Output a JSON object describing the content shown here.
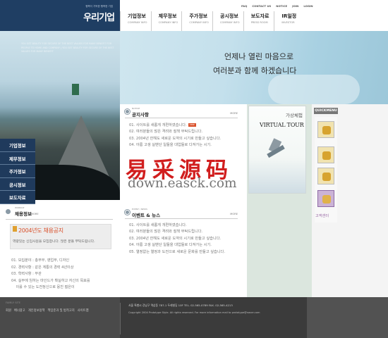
{
  "header": {
    "logo_sub": "행복이 가득한 행복한 기업",
    "logo": "우리기업",
    "util_links": [
      "FAQ",
      "CONTACT US",
      "NOTICE",
      "JOIN",
      "LOGIN"
    ],
    "nav": [
      {
        "ko": "기업정보",
        "en": "COMPANY INFO"
      },
      {
        "ko": "제무정보",
        "en": "COMPANY INFO"
      },
      {
        "ko": "주가정보",
        "en": "COMPANY INFO"
      },
      {
        "ko": "공시정보",
        "en": "COMPANY INFO"
      },
      {
        "ko": "보도자료",
        "en": "PRESS ROOM"
      },
      {
        "ko": "IR일정",
        "en": "INVESTOR"
      }
    ]
  },
  "photo": {
    "tagline": "YOU GET BEAUTY FOR SECURE OF THE BEST VALUES FOR MANY BENEFIT FOR PEOPLE TO HOME AND COMPANY | YOU GET BEAUTY FOR SECURE OF THE BEST VALUES FOR MANY BENEFIT"
  },
  "hero": {
    "line1": "언제나 열린 마음으로",
    "line2": "여러분과 함께 하겠습니다"
  },
  "submenu": [
    "기업정보",
    "제무정보",
    "주가정보",
    "공시정보",
    "보도자료"
  ],
  "notice": {
    "small": "NOTICE",
    "title": "공지사항",
    "more": "MORE",
    "new_badge": "new",
    "items": [
      "01. 사이트를 새롭게 개편하였습니다.",
      "02. 여러분들의 많은 격려와 질책 부탁드립니다.",
      "03. 2004년 한해도 새로운 도약의 시기로 만들고 싶습니다.",
      "04. 아름 고생 실밴단 일들을 대업들로 다져가는 시기."
    ]
  },
  "events": {
    "small": "EVENT / NEWS",
    "title": "이벤트 & 뉴스",
    "more": "MORE",
    "items": [
      "01. 사이트를 새롭게 개편하였습니다.",
      "02. 여러분들의 많은 격려와 질책 부탁드립니다.",
      "03. 2004년 한해도 새로운 도약의 시기로 만들고 싶습니다.",
      "04. 아름 고생 실밴단 일들을 대업들로 다져가는 시기.",
      "05. 열정없는 열정과 도전으로 새로운 문화를 만들고 싶습니다."
    ]
  },
  "tour": {
    "ko": "가상체험",
    "en": "VIRTUAL TOUR"
  },
  "watermark": {
    "cn": "易采源码",
    "url": "down.easck.com"
  },
  "quickmenu": {
    "title": "QUICKMENU",
    "label": "고객센터"
  },
  "recruit": {
    "small": "WORKUP",
    "title": "채용정보",
    "more": "MORE",
    "box_title": "2004년도 채용공지",
    "box_desc": "역량있는 신입사원을 모집합니다. 많은 분들 부탁드립니다.",
    "items": [
      "01. 모집분야 : 총무부, 영업부, 디자인",
      "02. 경력사항 : 같은 계통의 경력 4년이상",
      "03. 학력사항 : 무관",
      "04. 실무에 임하는 마인드가 확실하고 자신의 목표를",
      "    이룰 수 있는 도전정신으로 뭉친 젊은이"
    ]
  },
  "footer": {
    "family": "FAMILY SITE",
    "links": [
      "회원",
      "배너광고",
      "개인정보정책",
      "책임준과 및 법적고지",
      "사이트맵"
    ],
    "address": "서울 특별시 강남구 역삼동 787-1 두레빌딩 10F TEL. 02-565-0789 FAX. 02-565-4213",
    "copyright": "Copyright 2004 Prototype Style. All rights reserved.   For more information mail to prototype@naver.com"
  }
}
